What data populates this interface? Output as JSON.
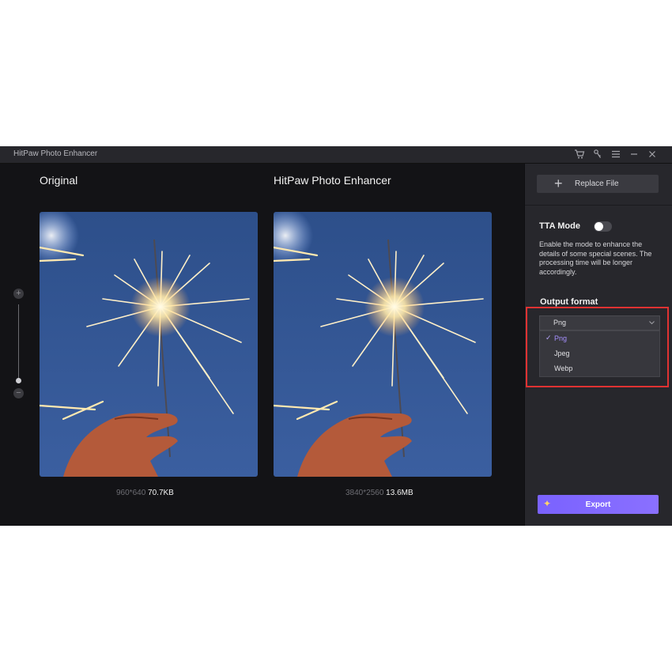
{
  "window": {
    "title": "HitPaw Photo Enhancer"
  },
  "titlebar_icons": [
    "cart-icon",
    "key-icon",
    "menu-icon",
    "minimize-icon",
    "close-icon"
  ],
  "panels": {
    "original": {
      "title": "Original",
      "dimensions": "960*640",
      "size": "70.7KB"
    },
    "enhanced": {
      "title": "HitPaw Photo Enhancer",
      "dimensions": "3840*2560",
      "size": "13.6MB"
    }
  },
  "zoom": {
    "plus": "+",
    "minus": "−"
  },
  "sidebar": {
    "replace_label": "Replace File",
    "tta_label": "TTA Mode",
    "tta_enabled": false,
    "tta_description": "Enable the mode to enhance the details of some special scenes. The processing time will be longer accordingly.",
    "output_format_label": "Output format",
    "selected_format": "Png",
    "format_options": [
      "Png",
      "Jpeg",
      "Webp"
    ],
    "export_label": "Export"
  },
  "colors": {
    "accent": "#7a62ff",
    "highlight": "#e03232",
    "background": "#131316"
  }
}
